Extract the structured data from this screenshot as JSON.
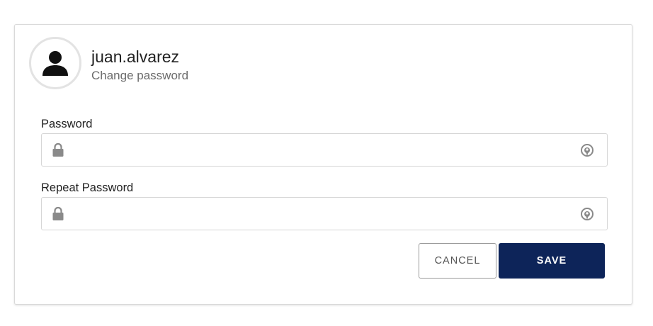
{
  "profile": {
    "username": "juan.alvarez",
    "subtitle": "Change password"
  },
  "form": {
    "password": {
      "label": "Password",
      "value": "",
      "placeholder": ""
    },
    "repeat_password": {
      "label": "Repeat Password",
      "value": "",
      "placeholder": ""
    }
  },
  "actions": {
    "cancel_label": "CANCEL",
    "save_label": "SAVE"
  },
  "icons": {
    "avatar": "user-silhouette-icon",
    "lock": "lock-icon",
    "reveal": "eye-toggle-icon"
  },
  "colors": {
    "primary": "#0d2459",
    "icon_gray": "#8a8a8a",
    "border": "#d6d6d6"
  }
}
